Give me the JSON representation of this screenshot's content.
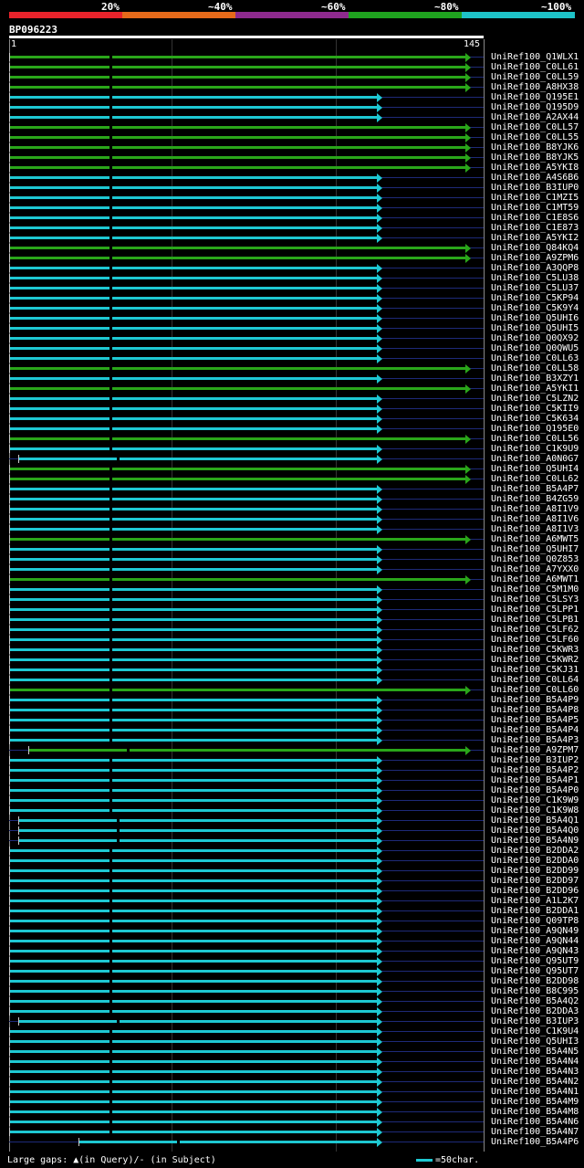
{
  "query": {
    "id": "BP096223",
    "start": "1",
    "end": "145"
  },
  "legend": [
    {
      "label": "20%",
      "color": "#e8232b"
    },
    {
      "label": "~40%",
      "color": "#e66a1a"
    },
    {
      "label": "~60%",
      "color": "#8e2a8e"
    },
    {
      "label": "~80%",
      "color": "#1fa31f"
    },
    {
      "label": "~100%",
      "color": "#1ec3c8"
    }
  ],
  "footer": {
    "text": "Large gaps: ▲(in Query)/- (in Subject)",
    "scale": "=50char."
  },
  "colors": {
    "green": "#2aa61a",
    "cyan": "#1ec8d2"
  },
  "hits": [
    {
      "name": "UniRef100_Q1WLX1",
      "c": "green",
      "s": 1,
      "e": 145
    },
    {
      "name": "UniRef100_C0LL61",
      "c": "green",
      "s": 1,
      "e": 145
    },
    {
      "name": "UniRef100_C0LL59",
      "c": "green",
      "s": 1,
      "e": 145
    },
    {
      "name": "UniRef100_A8HX38",
      "c": "green",
      "s": 1,
      "e": 145
    },
    {
      "name": "UniRef100_Q195E1",
      "c": "cyan",
      "s": 1,
      "e": 117
    },
    {
      "name": "UniRef100_Q195D9",
      "c": "cyan",
      "s": 1,
      "e": 117
    },
    {
      "name": "UniRef100_A2AX44",
      "c": "cyan",
      "s": 1,
      "e": 117
    },
    {
      "name": "UniRef100_C0LL57",
      "c": "green",
      "s": 1,
      "e": 145
    },
    {
      "name": "UniRef100_C0LL55",
      "c": "green",
      "s": 1,
      "e": 145
    },
    {
      "name": "UniRef100_B8YJK6",
      "c": "green",
      "s": 1,
      "e": 145
    },
    {
      "name": "UniRef100_B8YJK5",
      "c": "green",
      "s": 1,
      "e": 145
    },
    {
      "name": "UniRef100_A5YKI8",
      "c": "green",
      "s": 1,
      "e": 145
    },
    {
      "name": "UniRef100_A4S6B6",
      "c": "cyan",
      "s": 1,
      "e": 117
    },
    {
      "name": "UniRef100_B3IUP0",
      "c": "cyan",
      "s": 1,
      "e": 117
    },
    {
      "name": "UniRef100_C1MZI5",
      "c": "cyan",
      "s": 1,
      "e": 117
    },
    {
      "name": "UniRef100_C1MT59",
      "c": "cyan",
      "s": 1,
      "e": 117
    },
    {
      "name": "UniRef100_C1E8S6",
      "c": "cyan",
      "s": 1,
      "e": 117
    },
    {
      "name": "UniRef100_C1E873",
      "c": "cyan",
      "s": 1,
      "e": 117
    },
    {
      "name": "UniRef100_A5YKI2",
      "c": "cyan",
      "s": 1,
      "e": 117
    },
    {
      "name": "UniRef100_Q84KQ4",
      "c": "green",
      "s": 1,
      "e": 145
    },
    {
      "name": "UniRef100_A9ZPM6",
      "c": "green",
      "s": 1,
      "e": 145
    },
    {
      "name": "UniRef100_A3QQP8",
      "c": "cyan",
      "s": 1,
      "e": 117
    },
    {
      "name": "UniRef100_C5LU38",
      "c": "cyan",
      "s": 1,
      "e": 117
    },
    {
      "name": "UniRef100_C5LU37",
      "c": "cyan",
      "s": 1,
      "e": 117
    },
    {
      "name": "UniRef100_C5KP94",
      "c": "cyan",
      "s": 1,
      "e": 117
    },
    {
      "name": "UniRef100_C5K9Y4",
      "c": "cyan",
      "s": 1,
      "e": 117
    },
    {
      "name": "UniRef100_Q5UHI6",
      "c": "cyan",
      "s": 1,
      "e": 117
    },
    {
      "name": "UniRef100_Q5UHI5",
      "c": "cyan",
      "s": 1,
      "e": 117
    },
    {
      "name": "UniRef100_Q0QX92",
      "c": "cyan",
      "s": 1,
      "e": 117
    },
    {
      "name": "UniRef100_Q0QWU5",
      "c": "cyan",
      "s": 1,
      "e": 117
    },
    {
      "name": "UniRef100_C0LL63",
      "c": "cyan",
      "s": 1,
      "e": 117
    },
    {
      "name": "UniRef100_C0LL58",
      "c": "green",
      "s": 1,
      "e": 145
    },
    {
      "name": "UniRef100_B3XZY1",
      "c": "cyan",
      "s": 1,
      "e": 117
    },
    {
      "name": "UniRef100_A5YKI1",
      "c": "green",
      "s": 1,
      "e": 145
    },
    {
      "name": "UniRef100_C5LZN2",
      "c": "cyan",
      "s": 1,
      "e": 117
    },
    {
      "name": "UniRef100_C5KII9",
      "c": "cyan",
      "s": 1,
      "e": 117
    },
    {
      "name": "UniRef100_C5K634",
      "c": "cyan",
      "s": 1,
      "e": 117
    },
    {
      "name": "UniRef100_Q195E0",
      "c": "cyan",
      "s": 1,
      "e": 117
    },
    {
      "name": "UniRef100_C0LL56",
      "c": "green",
      "s": 1,
      "e": 145
    },
    {
      "name": "UniRef100_C1K9U9",
      "c": "cyan",
      "s": 1,
      "e": 117
    },
    {
      "name": "UniRef100_A0N0G7",
      "c": "cyan",
      "s": 4,
      "e": 117
    },
    {
      "name": "UniRef100_Q5UHI4",
      "c": "green",
      "s": 1,
      "e": 145
    },
    {
      "name": "UniRef100_C0LL62",
      "c": "green",
      "s": 1,
      "e": 145
    },
    {
      "name": "UniRef100_B5A4P7",
      "c": "cyan",
      "s": 1,
      "e": 117
    },
    {
      "name": "UniRef100_B4ZG59",
      "c": "cyan",
      "s": 1,
      "e": 117
    },
    {
      "name": "UniRef100_A8I1V9",
      "c": "cyan",
      "s": 1,
      "e": 117
    },
    {
      "name": "UniRef100_A8I1V6",
      "c": "cyan",
      "s": 1,
      "e": 117
    },
    {
      "name": "UniRef100_A8I1V3",
      "c": "cyan",
      "s": 1,
      "e": 117
    },
    {
      "name": "UniRef100_A6MWT5",
      "c": "green",
      "s": 1,
      "e": 145
    },
    {
      "name": "UniRef100_Q5UHI7",
      "c": "cyan",
      "s": 1,
      "e": 117
    },
    {
      "name": "UniRef100_Q0Z853",
      "c": "cyan",
      "s": 1,
      "e": 117
    },
    {
      "name": "UniRef100_A7YXX0",
      "c": "cyan",
      "s": 1,
      "e": 117
    },
    {
      "name": "UniRef100_A6MWT1",
      "c": "green",
      "s": 1,
      "e": 145
    },
    {
      "name": "UniRef100_C5M1M0",
      "c": "cyan",
      "s": 1,
      "e": 117
    },
    {
      "name": "UniRef100_C5LSY3",
      "c": "cyan",
      "s": 1,
      "e": 117
    },
    {
      "name": "UniRef100_C5LPP1",
      "c": "cyan",
      "s": 1,
      "e": 117
    },
    {
      "name": "UniRef100_C5LPB1",
      "c": "cyan",
      "s": 1,
      "e": 117
    },
    {
      "name": "UniRef100_C5LF62",
      "c": "cyan",
      "s": 1,
      "e": 117
    },
    {
      "name": "UniRef100_C5LF60",
      "c": "cyan",
      "s": 1,
      "e": 117
    },
    {
      "name": "UniRef100_C5KWR3",
      "c": "cyan",
      "s": 1,
      "e": 117
    },
    {
      "name": "UniRef100_C5KWR2",
      "c": "cyan",
      "s": 1,
      "e": 117
    },
    {
      "name": "UniRef100_C5KJ31",
      "c": "cyan",
      "s": 1,
      "e": 117
    },
    {
      "name": "UniRef100_C0LL64",
      "c": "cyan",
      "s": 1,
      "e": 117
    },
    {
      "name": "UniRef100_C0LL60",
      "c": "green",
      "s": 1,
      "e": 145
    },
    {
      "name": "UniRef100_B5A4P9",
      "c": "cyan",
      "s": 1,
      "e": 117
    },
    {
      "name": "UniRef100_B5A4P8",
      "c": "cyan",
      "s": 1,
      "e": 117
    },
    {
      "name": "UniRef100_B5A4P5",
      "c": "cyan",
      "s": 1,
      "e": 117
    },
    {
      "name": "UniRef100_B5A4P4",
      "c": "cyan",
      "s": 1,
      "e": 117
    },
    {
      "name": "UniRef100_B5A4P3",
      "c": "cyan",
      "s": 1,
      "e": 117
    },
    {
      "name": "UniRef100_A9ZPM7",
      "c": "green",
      "s": 7,
      "e": 145
    },
    {
      "name": "UniRef100_B3IUP2",
      "c": "cyan",
      "s": 1,
      "e": 117
    },
    {
      "name": "UniRef100_B5A4P2",
      "c": "cyan",
      "s": 1,
      "e": 117
    },
    {
      "name": "UniRef100_B5A4P1",
      "c": "cyan",
      "s": 1,
      "e": 117
    },
    {
      "name": "UniRef100_B5A4P0",
      "c": "cyan",
      "s": 1,
      "e": 117
    },
    {
      "name": "UniRef100_C1K9W9",
      "c": "cyan",
      "s": 1,
      "e": 117
    },
    {
      "name": "UniRef100_C1K9W8",
      "c": "cyan",
      "s": 1,
      "e": 117
    },
    {
      "name": "UniRef100_B5A4Q1",
      "c": "cyan",
      "s": 4,
      "e": 117
    },
    {
      "name": "UniRef100_B5A4Q0",
      "c": "cyan",
      "s": 4,
      "e": 117
    },
    {
      "name": "UniRef100_B5A4N9",
      "c": "cyan",
      "s": 4,
      "e": 117
    },
    {
      "name": "UniRef100_B2DDA2",
      "c": "cyan",
      "s": 1,
      "e": 117
    },
    {
      "name": "UniRef100_B2DDA0",
      "c": "cyan",
      "s": 1,
      "e": 117
    },
    {
      "name": "UniRef100_B2DD99",
      "c": "cyan",
      "s": 1,
      "e": 117
    },
    {
      "name": "UniRef100_B2DD97",
      "c": "cyan",
      "s": 1,
      "e": 117
    },
    {
      "name": "UniRef100_B2DD96",
      "c": "cyan",
      "s": 1,
      "e": 117
    },
    {
      "name": "UniRef100_A1L2K7",
      "c": "cyan",
      "s": 1,
      "e": 117
    },
    {
      "name": "UniRef100_B2DDA1",
      "c": "cyan",
      "s": 1,
      "e": 117
    },
    {
      "name": "UniRef100_Q09TP8",
      "c": "cyan",
      "s": 1,
      "e": 117
    },
    {
      "name": "UniRef100_A9QN49",
      "c": "cyan",
      "s": 1,
      "e": 117
    },
    {
      "name": "UniRef100_A9QN44",
      "c": "cyan",
      "s": 1,
      "e": 117
    },
    {
      "name": "UniRef100_A9QN43",
      "c": "cyan",
      "s": 1,
      "e": 117
    },
    {
      "name": "UniRef100_Q95UT9",
      "c": "cyan",
      "s": 1,
      "e": 117
    },
    {
      "name": "UniRef100_Q95UT7",
      "c": "cyan",
      "s": 1,
      "e": 117
    },
    {
      "name": "UniRef100_B2DD98",
      "c": "cyan",
      "s": 1,
      "e": 117
    },
    {
      "name": "UniRef100_B8C995",
      "c": "cyan",
      "s": 1,
      "e": 117
    },
    {
      "name": "UniRef100_B5A4Q2",
      "c": "cyan",
      "s": 1,
      "e": 117
    },
    {
      "name": "UniRef100_B2DDA3",
      "c": "cyan",
      "s": 1,
      "e": 117
    },
    {
      "name": "UniRef100_B3IUP3",
      "c": "cyan",
      "s": 4,
      "e": 117
    },
    {
      "name": "UniRef100_C1K9U4",
      "c": "cyan",
      "s": 1,
      "e": 117
    },
    {
      "name": "UniRef100_Q5UHI3",
      "c": "cyan",
      "s": 1,
      "e": 117
    },
    {
      "name": "UniRef100_B5A4N5",
      "c": "cyan",
      "s": 1,
      "e": 117
    },
    {
      "name": "UniRef100_B5A4N4",
      "c": "cyan",
      "s": 1,
      "e": 117
    },
    {
      "name": "UniRef100_B5A4N3",
      "c": "cyan",
      "s": 1,
      "e": 117
    },
    {
      "name": "UniRef100_B5A4N2",
      "c": "cyan",
      "s": 1,
      "e": 117
    },
    {
      "name": "UniRef100_B5A4N1",
      "c": "cyan",
      "s": 1,
      "e": 117
    },
    {
      "name": "UniRef100_B5A4M9",
      "c": "cyan",
      "s": 1,
      "e": 117
    },
    {
      "name": "UniRef100_B5A4M8",
      "c": "cyan",
      "s": 1,
      "e": 117
    },
    {
      "name": "UniRef100_B5A4N6",
      "c": "cyan",
      "s": 1,
      "e": 117
    },
    {
      "name": "UniRef100_B5A4N7",
      "c": "cyan",
      "s": 1,
      "e": 117
    },
    {
      "name": "UniRef100_B5A4P6",
      "c": "cyan",
      "s": 23,
      "e": 117
    }
  ]
}
